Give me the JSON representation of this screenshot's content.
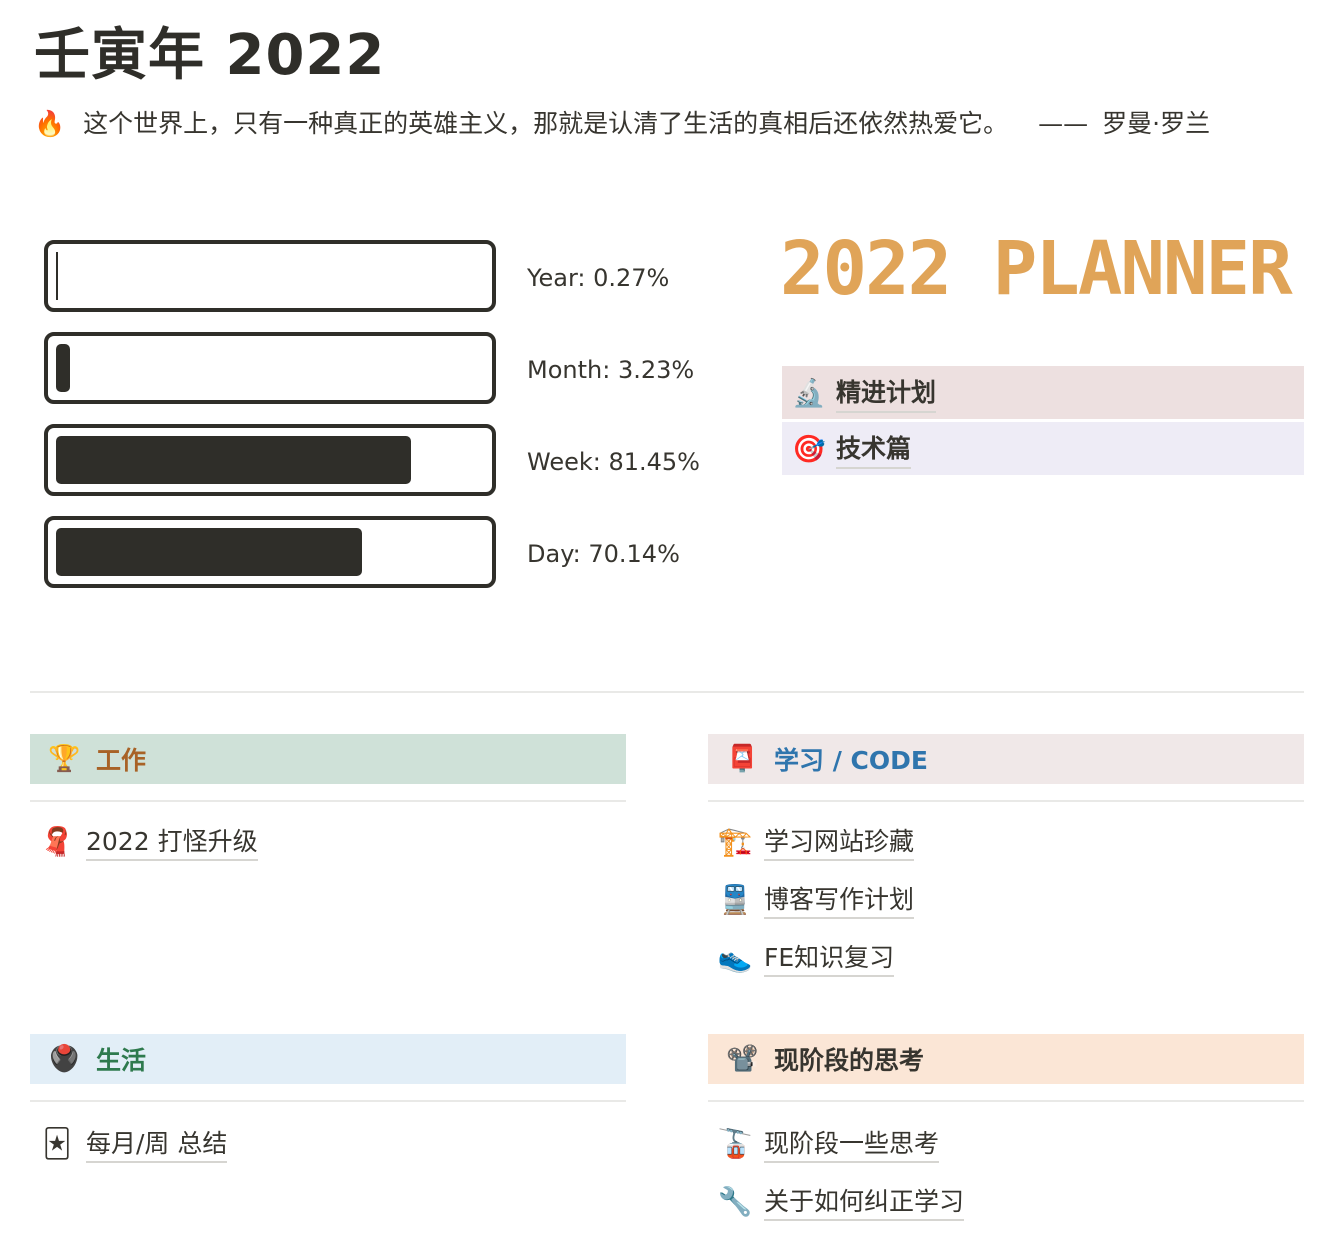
{
  "page": {
    "title": "壬寅年  2022",
    "quote": {
      "icon": "🔥",
      "text": "这个世界上，只有一种真正的英雄主义，那就是认清了生活的真相后还依然热爱它。",
      "separator": "——",
      "author": "罗曼·罗兰"
    }
  },
  "progress": [
    {
      "label": "Year: 0.27%",
      "value": 0.0027
    },
    {
      "label": "Month: 3.23%",
      "value": 0.0323
    },
    {
      "label": "Week: 81.45%",
      "value": 0.8145
    },
    {
      "label": "Day: 70.14%",
      "value": 0.7014
    }
  ],
  "planner": {
    "image_text": "2022 PLANNER",
    "items": [
      {
        "icon": "🔬",
        "label": "精进计划",
        "bg": "#ede0e0"
      },
      {
        "icon": "🎯",
        "label": "技术篇",
        "bg": "#eeecf6"
      }
    ]
  },
  "sections": {
    "work": {
      "icon": "🏆",
      "title": "工作",
      "bg": "#cfe1d8",
      "color": "#a86226",
      "items": [
        {
          "icon": "🧣",
          "label": "2022 打怪升级"
        }
      ]
    },
    "study": {
      "icon": "📮",
      "title": "学习 / CODE",
      "bg": "#f0e8e8",
      "color": "#2f75ad",
      "items": [
        {
          "icon": "🏗️",
          "label": "学习网站珍藏"
        },
        {
          "icon": "🚆",
          "label": "博客写作计划"
        },
        {
          "icon": "👟",
          "label": "FE知识复习"
        }
      ]
    },
    "life": {
      "icon": "🖲️",
      "title": "生活",
      "bg": "#e2eef7",
      "color": "#2e7a4e",
      "items": [
        {
          "icon": "🃏",
          "label": "每月/周 总结"
        }
      ]
    },
    "thinking": {
      "icon": "📽️",
      "title": "现阶段的思考",
      "bg": "#fbe6d6",
      "color": "#37352f",
      "items": [
        {
          "icon": "🚡",
          "label": "现阶段一些思考"
        },
        {
          "icon": "🔧",
          "label": "关于如何纠正学习"
        }
      ]
    }
  }
}
